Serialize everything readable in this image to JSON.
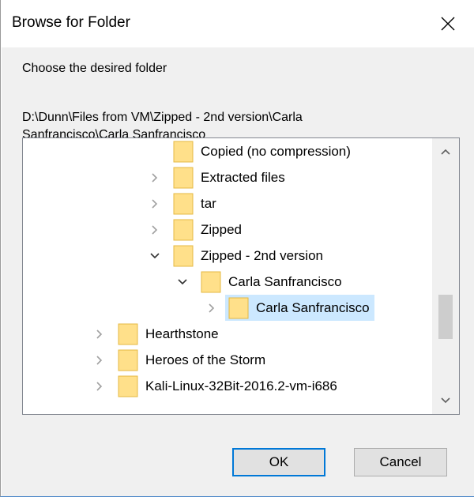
{
  "window": {
    "title": "Browse for Folder",
    "close_icon": "close-icon"
  },
  "prompt": "Choose the desired folder",
  "path": {
    "line1": "D:\\Dunn\\Files from VM\\Zipped - 2nd version\\Carla",
    "line2": "Sanfrancisco\\Carla Sanfrancisco"
  },
  "tree": {
    "items": [
      {
        "label": "Copied (no compression)",
        "expander": "none",
        "selected": false
      },
      {
        "label": "Extracted files",
        "expander": "collapsed",
        "selected": false
      },
      {
        "label": "tar",
        "expander": "collapsed",
        "selected": false
      },
      {
        "label": "Zipped",
        "expander": "collapsed",
        "selected": false
      },
      {
        "label": "Zipped - 2nd version",
        "expander": "expanded",
        "selected": false
      },
      {
        "label": "Carla Sanfrancisco",
        "expander": "expanded",
        "selected": false
      },
      {
        "label": "Carla Sanfrancisco",
        "expander": "collapsed",
        "selected": true
      },
      {
        "label": "Hearthstone",
        "expander": "collapsed",
        "selected": false
      },
      {
        "label": "Heroes of the Storm",
        "expander": "collapsed",
        "selected": false
      },
      {
        "label": "Kali-Linux-32Bit-2016.2-vm-i686",
        "expander": "collapsed",
        "selected": false
      }
    ]
  },
  "buttons": {
    "ok": "OK",
    "cancel": "Cancel"
  },
  "colors": {
    "selection": "#cce8ff",
    "folder": "#ffe08a",
    "accent": "#0078d7"
  }
}
